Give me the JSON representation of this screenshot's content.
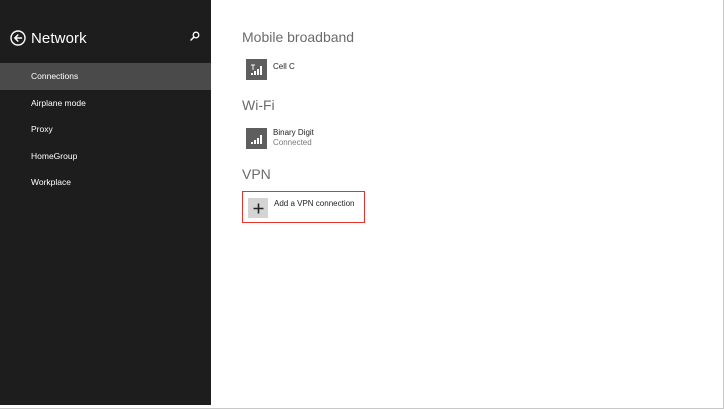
{
  "sidebar": {
    "title": "Network",
    "items": [
      {
        "label": "Connections",
        "selected": true
      },
      {
        "label": "Airplane mode",
        "selected": false
      },
      {
        "label": "Proxy",
        "selected": false
      },
      {
        "label": "HomeGroup",
        "selected": false
      },
      {
        "label": "Workplace",
        "selected": false
      }
    ]
  },
  "main": {
    "mobile_broadband": {
      "title": "Mobile broadband",
      "connection": {
        "name": "Cell C",
        "icon": "cellular-signal-icon"
      }
    },
    "wifi": {
      "title": "Wi-Fi",
      "connection": {
        "name": "Binary Digit",
        "status": "Connected",
        "icon": "wifi-signal-icon"
      }
    },
    "vpn": {
      "title": "VPN",
      "add_label": "Add a VPN connection",
      "icon": "plus-icon"
    }
  },
  "colors": {
    "sidebar_bg": "#1d1d1d",
    "selected_bg": "#4a4a4a",
    "highlight_border": "#e8322e",
    "tile_bg": "#5e5e5e"
  }
}
